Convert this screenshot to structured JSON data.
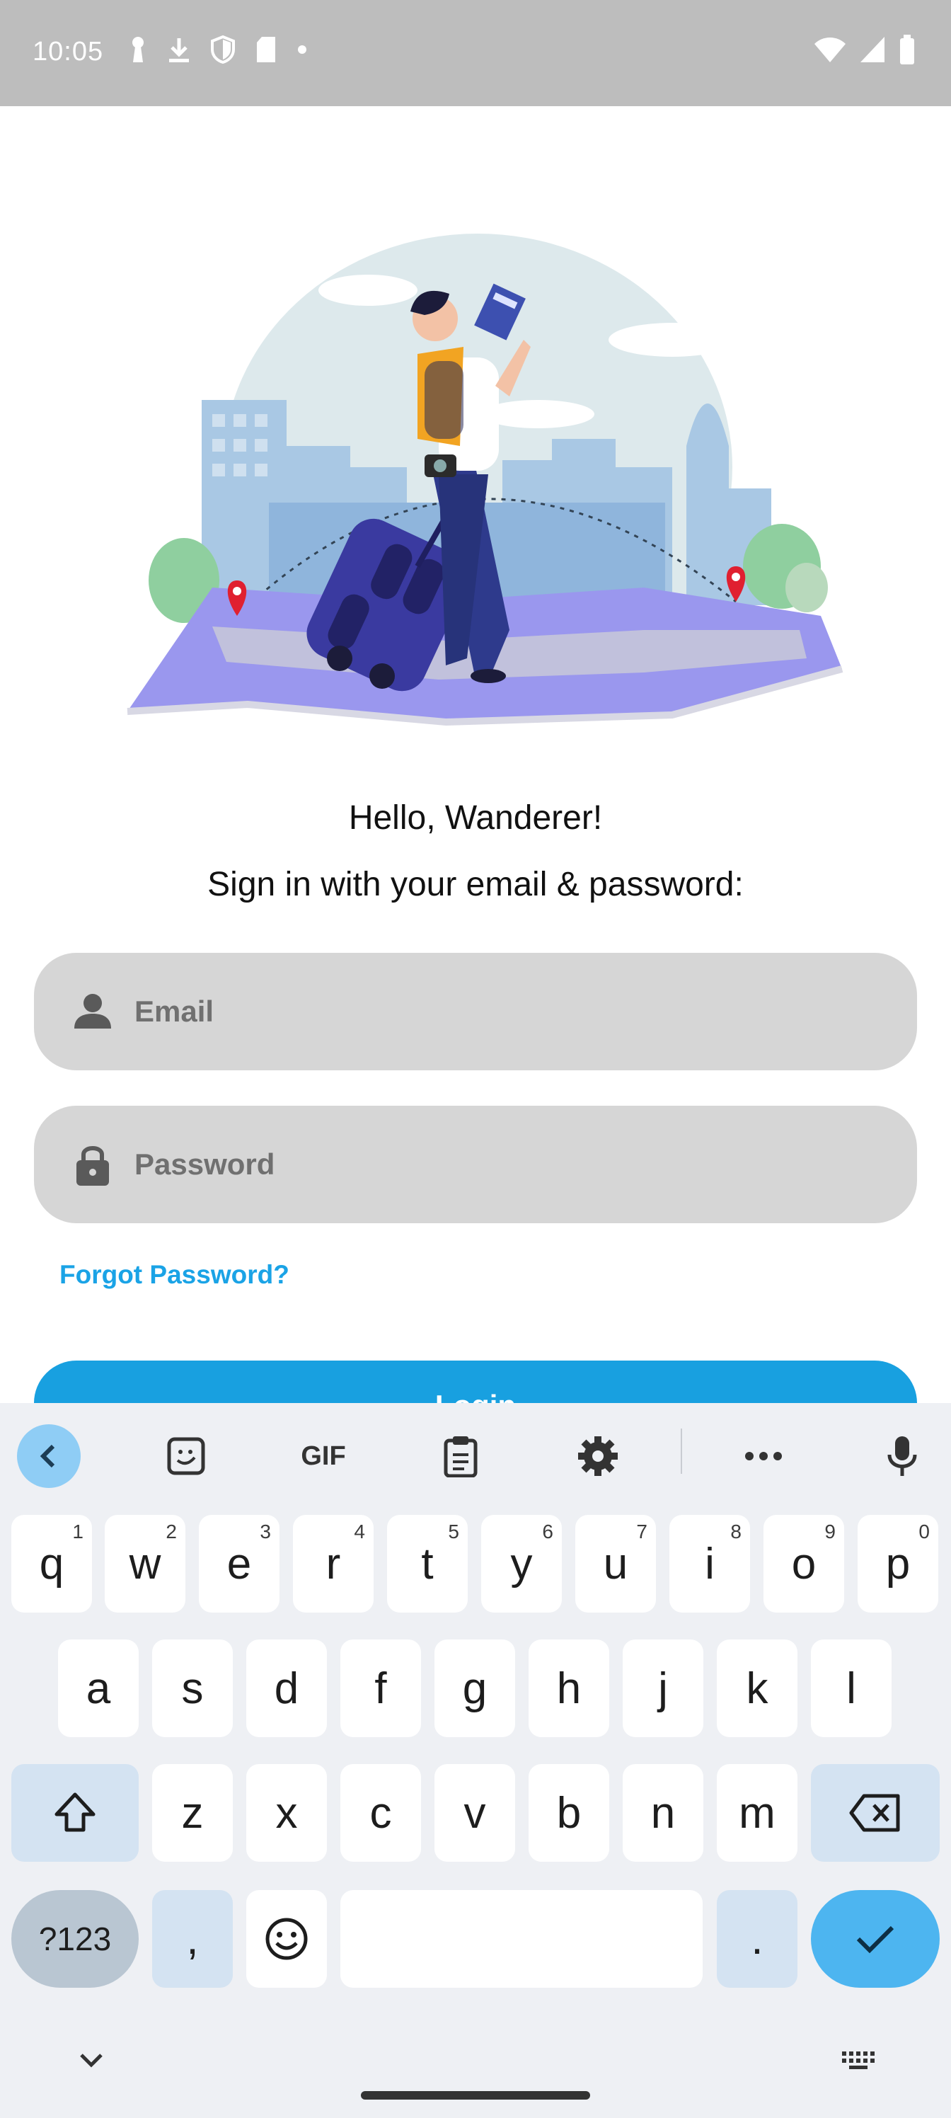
{
  "status_bar": {
    "time": "10:05",
    "left_icons": [
      "keyhole-icon",
      "download-icon",
      "shield-icon",
      "sd-card-icon",
      "dot-icon"
    ],
    "right_icons": [
      "wifi-icon",
      "signal-icon",
      "battery-icon"
    ]
  },
  "hero": {
    "image": "traveler-with-suitcase-illustration"
  },
  "texts": {
    "greeting": "Hello, Wanderer!",
    "subtitle": "Sign in with your email & password:"
  },
  "form": {
    "email_placeholder": "Email",
    "email_value": "",
    "password_placeholder": "Password",
    "password_value": "",
    "forgot_label": "Forgot Password?",
    "login_label": "Login"
  },
  "colors": {
    "accent": "#18a0e0",
    "link": "#1aa3e6",
    "field_bg": "#d6d6d6",
    "status_bar": "#bdbdbd"
  },
  "keyboard": {
    "toolbar": [
      "back-icon",
      "sticker-icon",
      "GIF",
      "clipboard-icon",
      "settings-icon",
      "more-icon",
      "mic-icon"
    ],
    "row1": [
      {
        "k": "q",
        "h": "1"
      },
      {
        "k": "w",
        "h": "2"
      },
      {
        "k": "e",
        "h": "3"
      },
      {
        "k": "r",
        "h": "4"
      },
      {
        "k": "t",
        "h": "5"
      },
      {
        "k": "y",
        "h": "6"
      },
      {
        "k": "u",
        "h": "7"
      },
      {
        "k": "i",
        "h": "8"
      },
      {
        "k": "o",
        "h": "9"
      },
      {
        "k": "p",
        "h": "0"
      }
    ],
    "row2": [
      "a",
      "s",
      "d",
      "f",
      "g",
      "h",
      "j",
      "k",
      "l"
    ],
    "row3": [
      "z",
      "x",
      "c",
      "v",
      "b",
      "n",
      "m"
    ],
    "symbols_label": "?123",
    "comma": ",",
    "period": "."
  }
}
